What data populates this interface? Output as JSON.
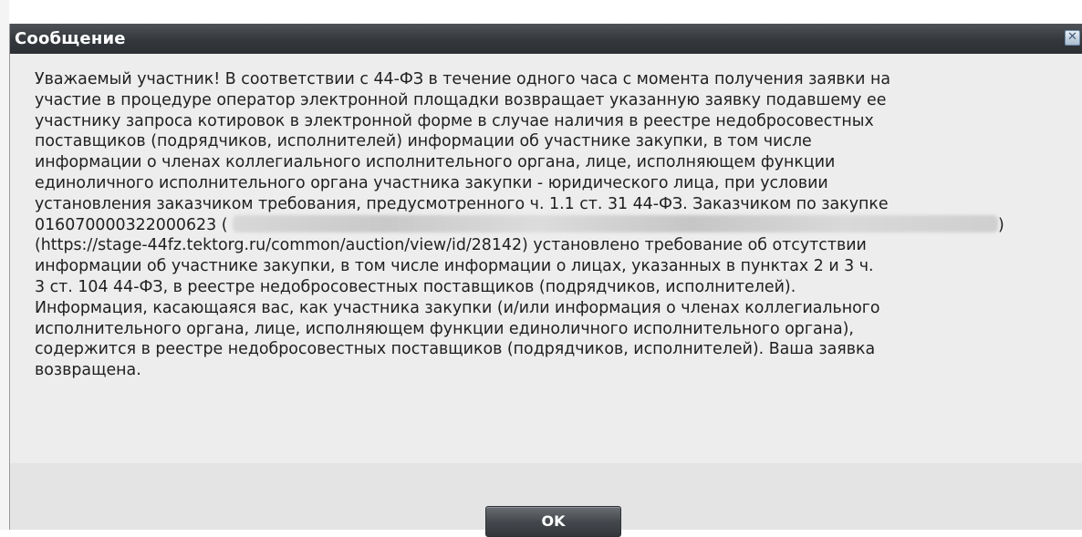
{
  "dialog": {
    "title": "Сообщение",
    "close_icon": "close-icon",
    "message": {
      "lines": [
        "Уважаемый участник! В соответствии с 44-ФЗ в течение одного часа с момента получения заявки на",
        "участие в процедуре оператор электронной площадки возвращает указанную заявку подавшему ее",
        "участнику запроса котировок в электронной форме в случае наличия в реестре недобросовестных",
        "поставщиков (подрядчиков, исполнителей) информации об участнике закупки, в том числе",
        "информации о членах коллегиального исполнительного органа, лице, исполняющем функции",
        "единоличного исполнительного органа участника закупки - юридического лица, при условии",
        "установления заказчиком требования, предусмотренного ч. 1.1 ст. 31 44-ФЗ. Заказчиком по закупке"
      ],
      "purchase_number_prefix": "0160700003220006 23 (",
      "purchase_close": ")",
      "lines_after": [
        "(https://stage-44fz.tektorg.ru/common/auction/view/id/28142) установлено требование об отсутствии",
        "информации об участнике закупки, в том числе информации о лицах, указанных в пунктах 2 и 3 ч.",
        "3 ст. 104 44-ФЗ, в реестре недобросовестных поставщиков (подрядчиков, исполнителей).",
        "Информация, касающаяся вас, как участника закупки (и/или информация о членах коллегиального",
        "исполнительного органа, лице, исполняющем функции единоличного исполнительного органа),",
        "содержится в реестре недобросовестных поставщиков (подрядчиков, исполнителей). Ваша заявка",
        "возвращена."
      ]
    },
    "ok_label": "OK"
  }
}
